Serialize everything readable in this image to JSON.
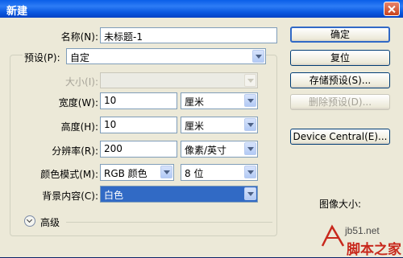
{
  "window": {
    "title": "新建"
  },
  "form": {
    "name": {
      "label": "名称(N):",
      "value": "未标题-1"
    },
    "preset": {
      "label": "预设(P):",
      "value": "自定"
    },
    "size": {
      "label": "大小(I):",
      "value": ""
    },
    "width": {
      "label": "宽度(W):",
      "value": "10",
      "unit": "厘米"
    },
    "height": {
      "label": "高度(H):",
      "value": "10",
      "unit": "厘米"
    },
    "resolution": {
      "label": "分辨率(R):",
      "value": "200",
      "unit": "像素/英寸"
    },
    "color_mode": {
      "label": "颜色模式(M):",
      "value": "RGB 颜色",
      "depth": "8 位"
    },
    "background": {
      "label": "背景内容(C):",
      "value": "白色"
    },
    "advanced": {
      "label": "高级"
    }
  },
  "buttons": {
    "ok": "确定",
    "reset": "复位",
    "save_preset": "存储预设(S)...",
    "delete_preset": "删除预设(D)...",
    "device_central": "Device Central(E)..."
  },
  "image_size": {
    "label": "图像大小:"
  },
  "watermark": {
    "site": "jb51.net",
    "brand": "脚本之家"
  }
}
